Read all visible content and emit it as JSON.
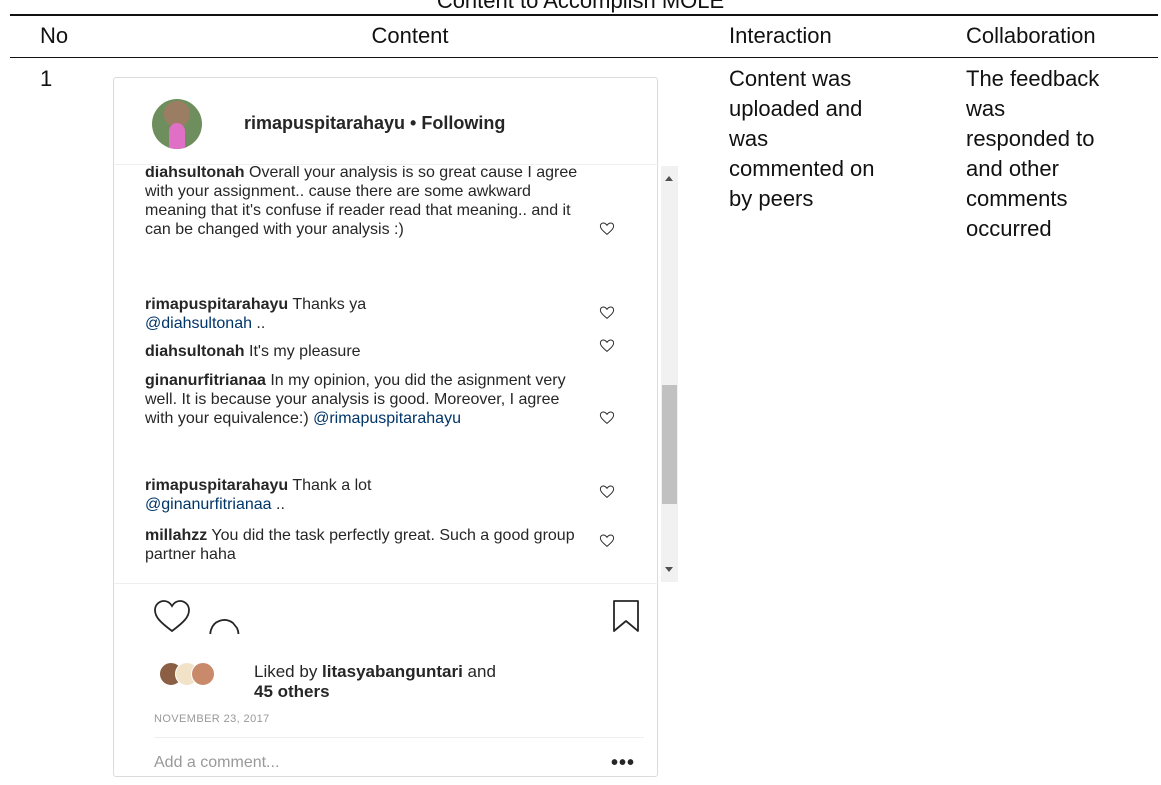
{
  "caption": "Content to Accomplish MOLE",
  "table": {
    "headers": {
      "no": "No",
      "content": "Content",
      "interaction": "Interaction",
      "collaboration": "Collaboration"
    },
    "row": {
      "no": "1",
      "interaction": "Content was\nuploaded and\nwas\ncommented on\nby peers",
      "collaboration": "The feedback\nwas\nresponded to\nand other\ncomments\noccurred"
    }
  },
  "post": {
    "username": "rimapuspitarahayu • Following",
    "comments": [
      {
        "user": "diahsultonah",
        "text": " Overall your analysis is so great cause I agree with your assignment.. cause there are some awkward meaning that it's confuse if reader read that meaning.. and it can be changed with your analysis :)",
        "mention": ""
      },
      {
        "user": "rimapuspitarahayu",
        "text": " Thanks ya ",
        "mention": "@diahsultonah",
        "tail": " .."
      },
      {
        "user": "diahsultonah",
        "text": " It's my pleasure",
        "mention": ""
      },
      {
        "user": "ginanurfitrianaa",
        "text": " In my opinion, you did the asignment very well. It is because your analysis is good. Moreover, I agree with your equivalence:) ",
        "mention": "@rimapuspitarahayu"
      },
      {
        "user": "rimapuspitarahayu",
        "text": " Thank a lot ",
        "mention": "@ginanurfitrianaa",
        "tail": " .."
      },
      {
        "user": "millahzz",
        "text": " You did the task perfectly great. Such a good group partner haha",
        "mention": ""
      }
    ],
    "likes": {
      "prefix": "Liked by ",
      "user": "litasyabanguntari",
      "suffix": " and",
      "others": "45 others"
    },
    "date": "NOVEMBER 23, 2017",
    "add_comment_placeholder": "Add a comment...",
    "more_label": "•••",
    "icons": [
      "heart-outline-icon",
      "comment-bubble-icon",
      "bookmark-icon",
      "more-icon"
    ]
  }
}
